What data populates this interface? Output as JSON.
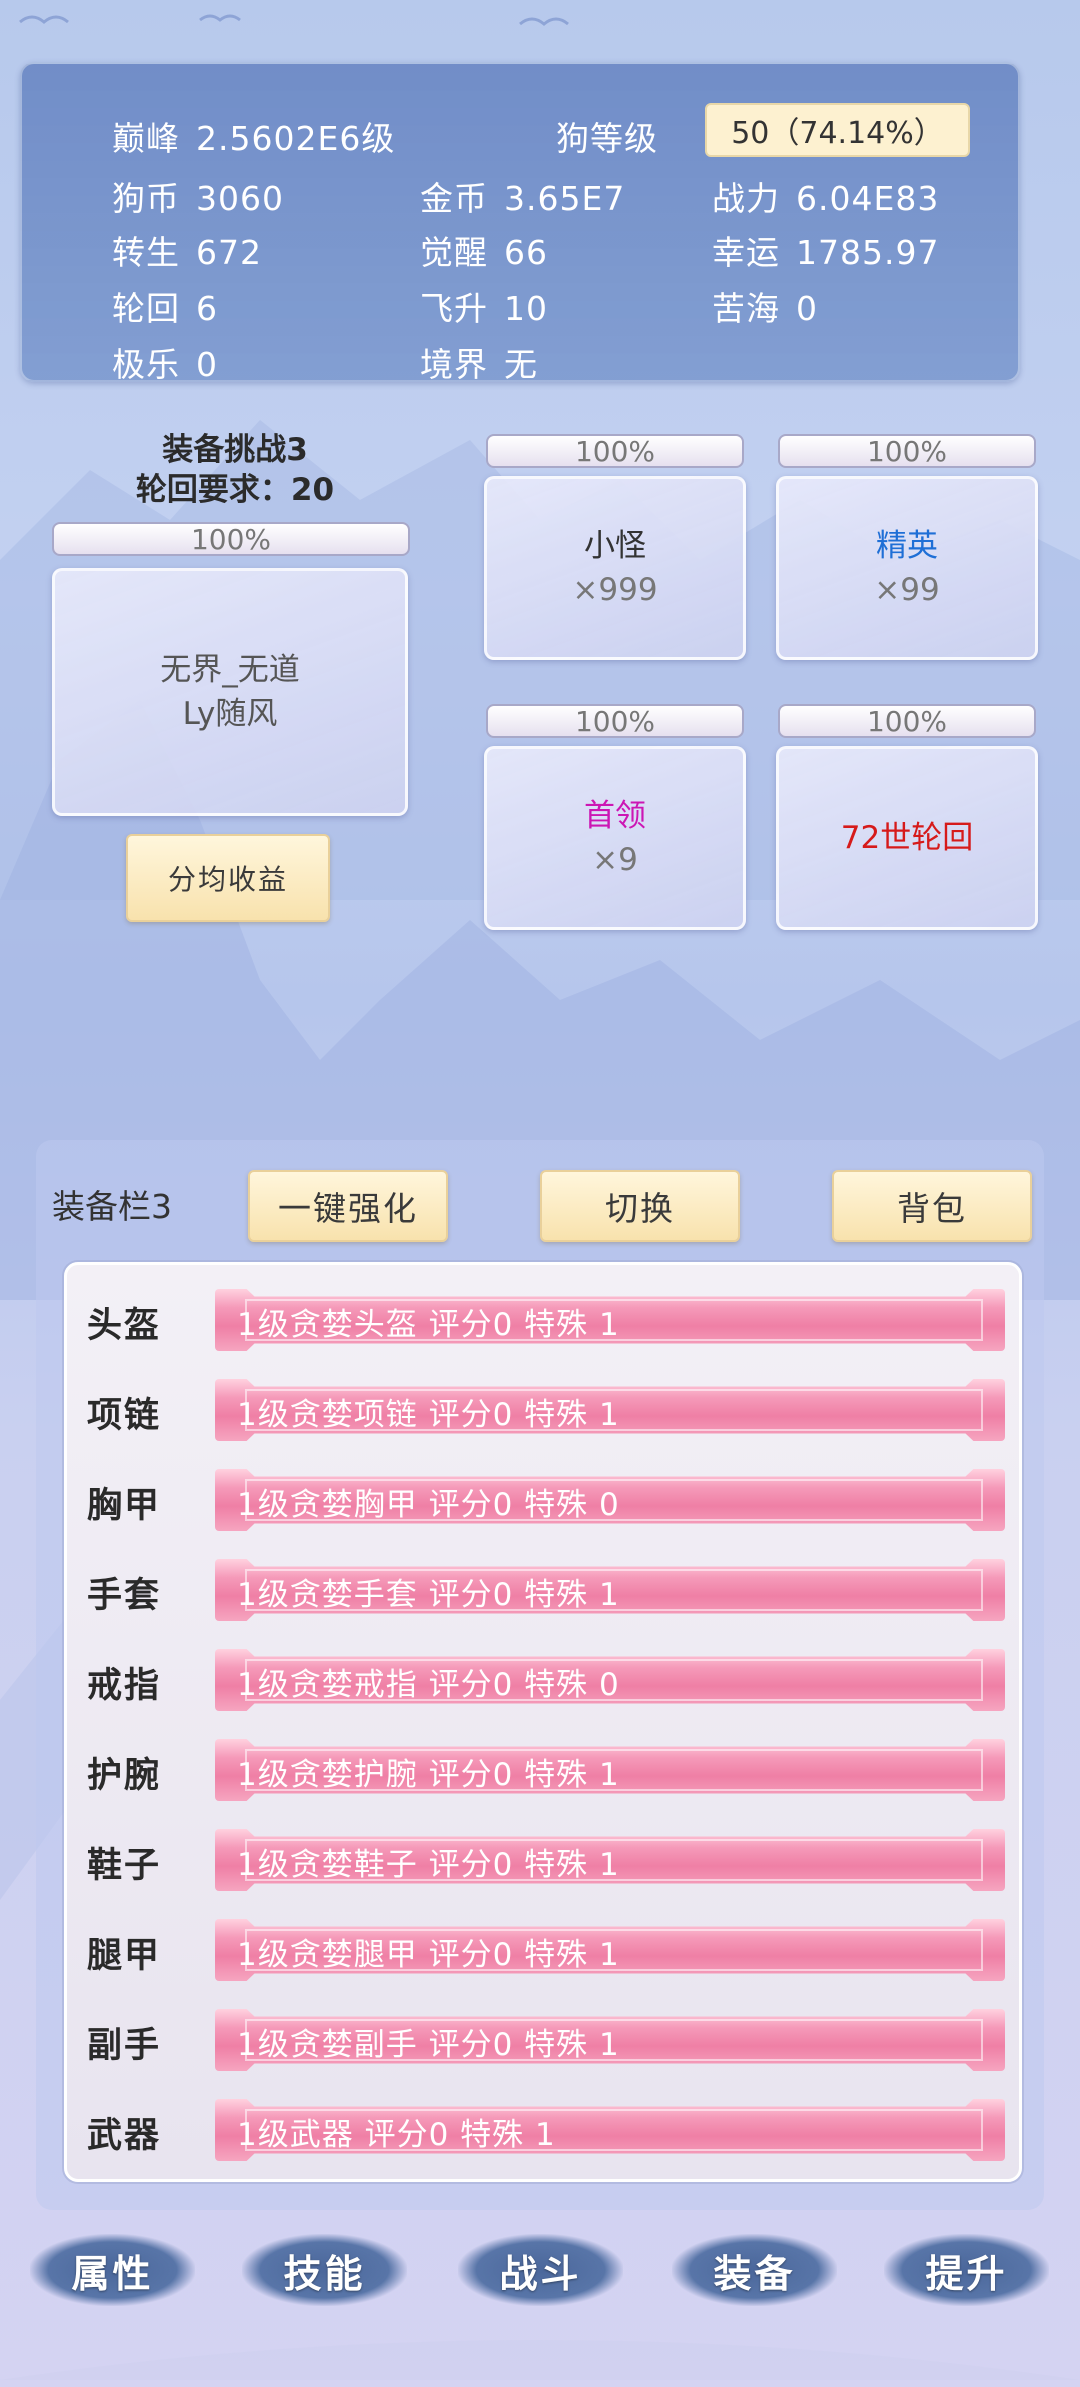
{
  "stats": {
    "peak": {
      "label": "巅峰",
      "value": "2.5602E6级"
    },
    "dog_level": {
      "label": "狗等级",
      "value": "50（74.14%）"
    },
    "dog_coin": {
      "label": "狗币",
      "value": "3060"
    },
    "gold_coin": {
      "label": "金币",
      "value": "3.65E7"
    },
    "power": {
      "label": "战力",
      "value": "6.04E83"
    },
    "rebirth": {
      "label": "转生",
      "value": "672"
    },
    "awaken": {
      "label": "觉醒",
      "value": "66"
    },
    "luck": {
      "label": "幸运",
      "value": "1785.97"
    },
    "samsara": {
      "label": "轮回",
      "value": "6"
    },
    "ascend": {
      "label": "飞升",
      "value": "10"
    },
    "bitter_sea": {
      "label": "苦海",
      "value": "0"
    },
    "bliss": {
      "label": "极乐",
      "value": "0"
    },
    "realm": {
      "label": "境界",
      "value": "无"
    }
  },
  "challenge": {
    "title": "装备挑战3",
    "requirement": "轮回要求：20",
    "main_progress": "100%",
    "boss_name_line1": "无界_无道",
    "boss_name_line2": "Ly随风",
    "share_button": "分均收益",
    "enemies": [
      {
        "name": "小怪",
        "count": "×999",
        "progress": "100%",
        "color": "#333333"
      },
      {
        "name": "精英",
        "count": "×99",
        "progress": "100%",
        "color": "#1f6fd6"
      },
      {
        "name": "首领",
        "count": "×9",
        "progress": "100%",
        "color": "#cc16b4"
      },
      {
        "name": "72世轮回",
        "count": "",
        "progress": "100%",
        "color": "#d61a1a"
      }
    ]
  },
  "equipment": {
    "label": "装备栏3",
    "enhance_button": "一键强化",
    "switch_button": "切换",
    "bag_button": "背包",
    "slots": [
      {
        "slot": "头盔",
        "text": "1级贪婪头盔 评分0 特殊 1"
      },
      {
        "slot": "项链",
        "text": "1级贪婪项链 评分0 特殊 1"
      },
      {
        "slot": "胸甲",
        "text": "1级贪婪胸甲 评分0 特殊 0"
      },
      {
        "slot": "手套",
        "text": "1级贪婪手套 评分0 特殊 1"
      },
      {
        "slot": "戒指",
        "text": "1级贪婪戒指 评分0 特殊 0"
      },
      {
        "slot": "护腕",
        "text": "1级贪婪护腕 评分0 特殊 1"
      },
      {
        "slot": "鞋子",
        "text": "1级贪婪鞋子 评分0 特殊 1"
      },
      {
        "slot": "腿甲",
        "text": "1级贪婪腿甲 评分0 特殊 1"
      },
      {
        "slot": "副手",
        "text": "1级贪婪副手 评分0 特殊 1"
      },
      {
        "slot": "武器",
        "text": "1级武器 评分0 特殊 1"
      }
    ]
  },
  "nav": [
    "属性",
    "技能",
    "战斗",
    "装备",
    "提升"
  ]
}
